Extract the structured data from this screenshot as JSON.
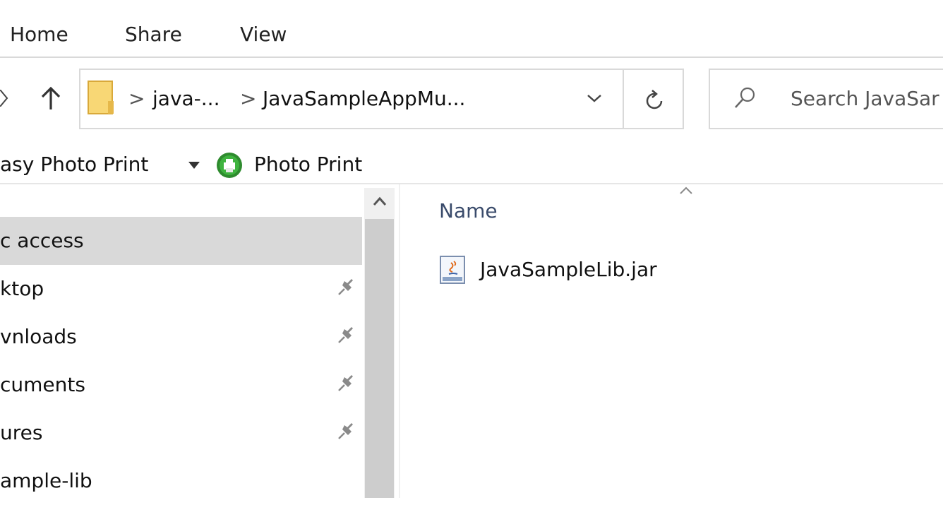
{
  "ribbon": {
    "tabs": [
      {
        "label": "Home"
      },
      {
        "label": "Share"
      },
      {
        "label": "View"
      }
    ]
  },
  "address_bar": {
    "segments": [
      "java-...",
      "JavaSampleAppMu..."
    ],
    "separator": ">"
  },
  "search": {
    "placeholder": "Search JavaSar"
  },
  "toolbar": {
    "easy_photo_print": "asy Photo Print",
    "photo_print": "Photo Print"
  },
  "sidebar": {
    "items": [
      {
        "label": "c access",
        "selected": true,
        "pinned": false
      },
      {
        "label": "ktop",
        "selected": false,
        "pinned": true
      },
      {
        "label": "vnloads",
        "selected": false,
        "pinned": true
      },
      {
        "label": "cuments",
        "selected": false,
        "pinned": true
      },
      {
        "label": "ures",
        "selected": false,
        "pinned": true
      },
      {
        "label": "ample-lib",
        "selected": false,
        "pinned": false
      }
    ]
  },
  "file_list": {
    "column_header": "Name",
    "files": [
      {
        "name": "JavaSampleLib.jar",
        "icon": "jar-file-icon"
      }
    ]
  },
  "colors": {
    "selection": "#d9d9d9",
    "border": "#d9d9d9",
    "folder": "#f8d775",
    "photo_print_green": "#2e8b2e"
  }
}
